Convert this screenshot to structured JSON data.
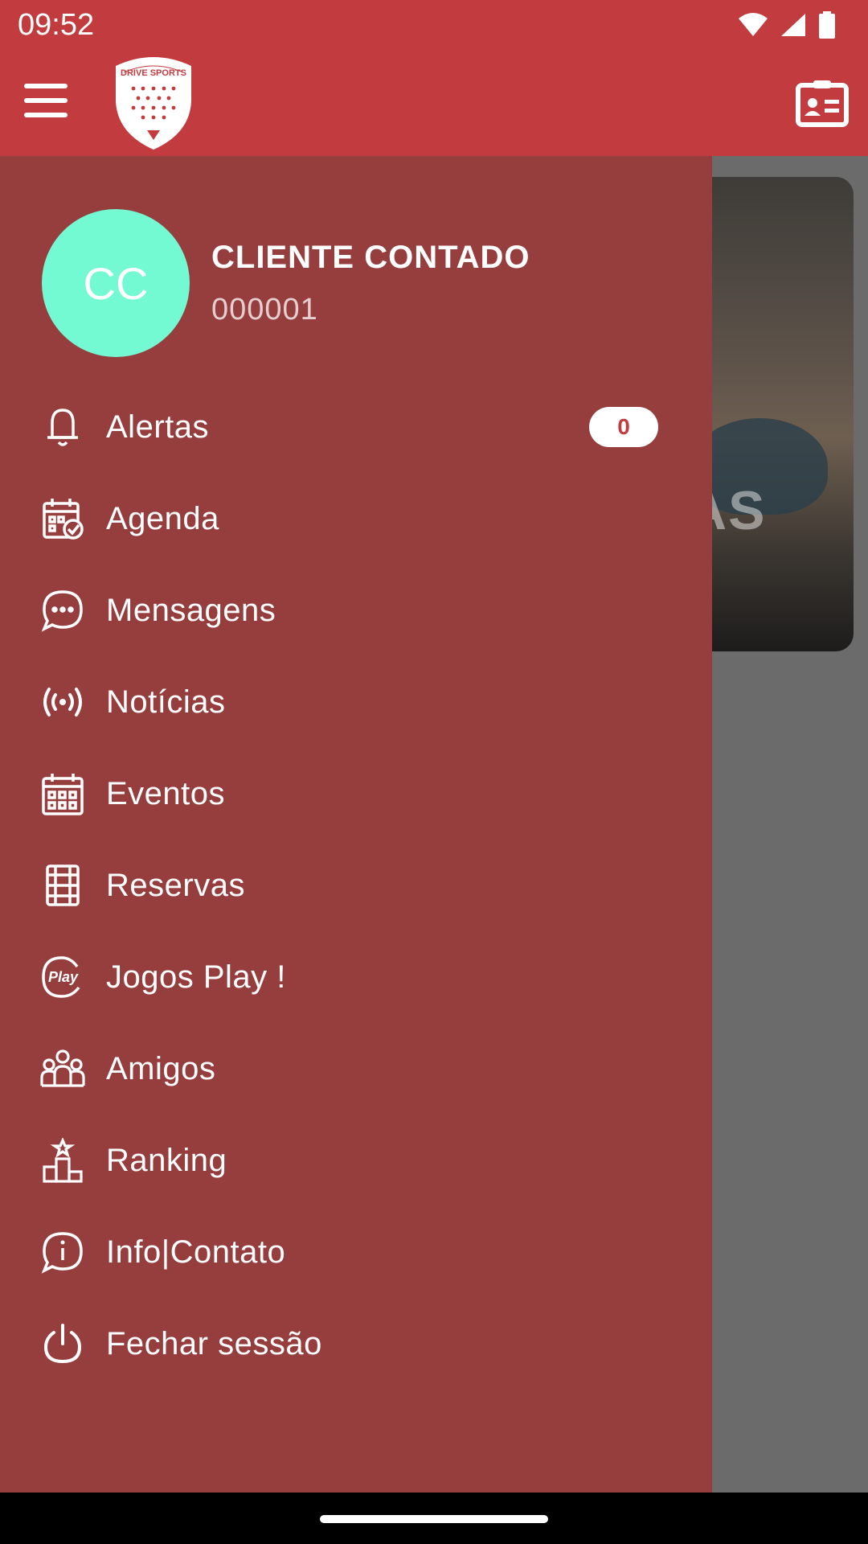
{
  "status_bar": {
    "time": "09:52"
  },
  "app_bar": {
    "brand_logo_text": "DRIVE SPORTS",
    "menu_icon": "hamburger-icon",
    "profile_card_icon": "id-card-icon"
  },
  "user": {
    "initials": "CC",
    "name": "CLIENTE CONTADO",
    "id": "000001"
  },
  "menu": {
    "items": [
      {
        "label": "Alertas",
        "icon": "bell-icon",
        "badge": "0"
      },
      {
        "label": "Agenda",
        "icon": "calendar-check-icon"
      },
      {
        "label": "Mensagens",
        "icon": "chat-bubble-icon"
      },
      {
        "label": "Notícias",
        "icon": "broadcast-icon"
      },
      {
        "label": "Eventos",
        "icon": "calendar-grid-icon"
      },
      {
        "label": "Reservas",
        "icon": "court-icon"
      },
      {
        "label": "Jogos Play !",
        "icon": "play-icon"
      },
      {
        "label": "Amigos",
        "icon": "group-icon"
      },
      {
        "label": "Ranking",
        "icon": "podium-icon"
      },
      {
        "label": "Info|Contato",
        "icon": "info-bubble-icon"
      },
      {
        "label": "Fechar sessão",
        "icon": "power-icon"
      }
    ]
  },
  "background_card": {
    "partial_text": "AS"
  },
  "colors": {
    "primary": "#c13b3f",
    "drawer": "#963d3e",
    "avatar": "#74fad2",
    "scrim": "#6b6b6b"
  }
}
